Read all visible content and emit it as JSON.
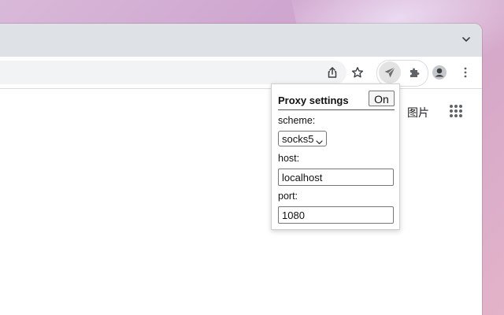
{
  "browser": {
    "toolbar": {
      "icons": [
        "share-icon",
        "bookmark-star-icon",
        "proxy-extension-icon",
        "extensions-puzzle-icon",
        "profile-avatar-icon",
        "more-menu-icon"
      ]
    },
    "page": {
      "images_link": "图片"
    }
  },
  "popup": {
    "title": "Proxy settings",
    "toggle_label": "On",
    "scheme_label": "scheme:",
    "scheme_value": "socks5",
    "host_label": "host:",
    "host_value": "localhost",
    "port_label": "port:",
    "port_value": "1080"
  },
  "colors": {
    "tabstrip": "#dee1e6",
    "omnibox": "#f1f3f4",
    "wallpaper": "#d3a6c9"
  }
}
